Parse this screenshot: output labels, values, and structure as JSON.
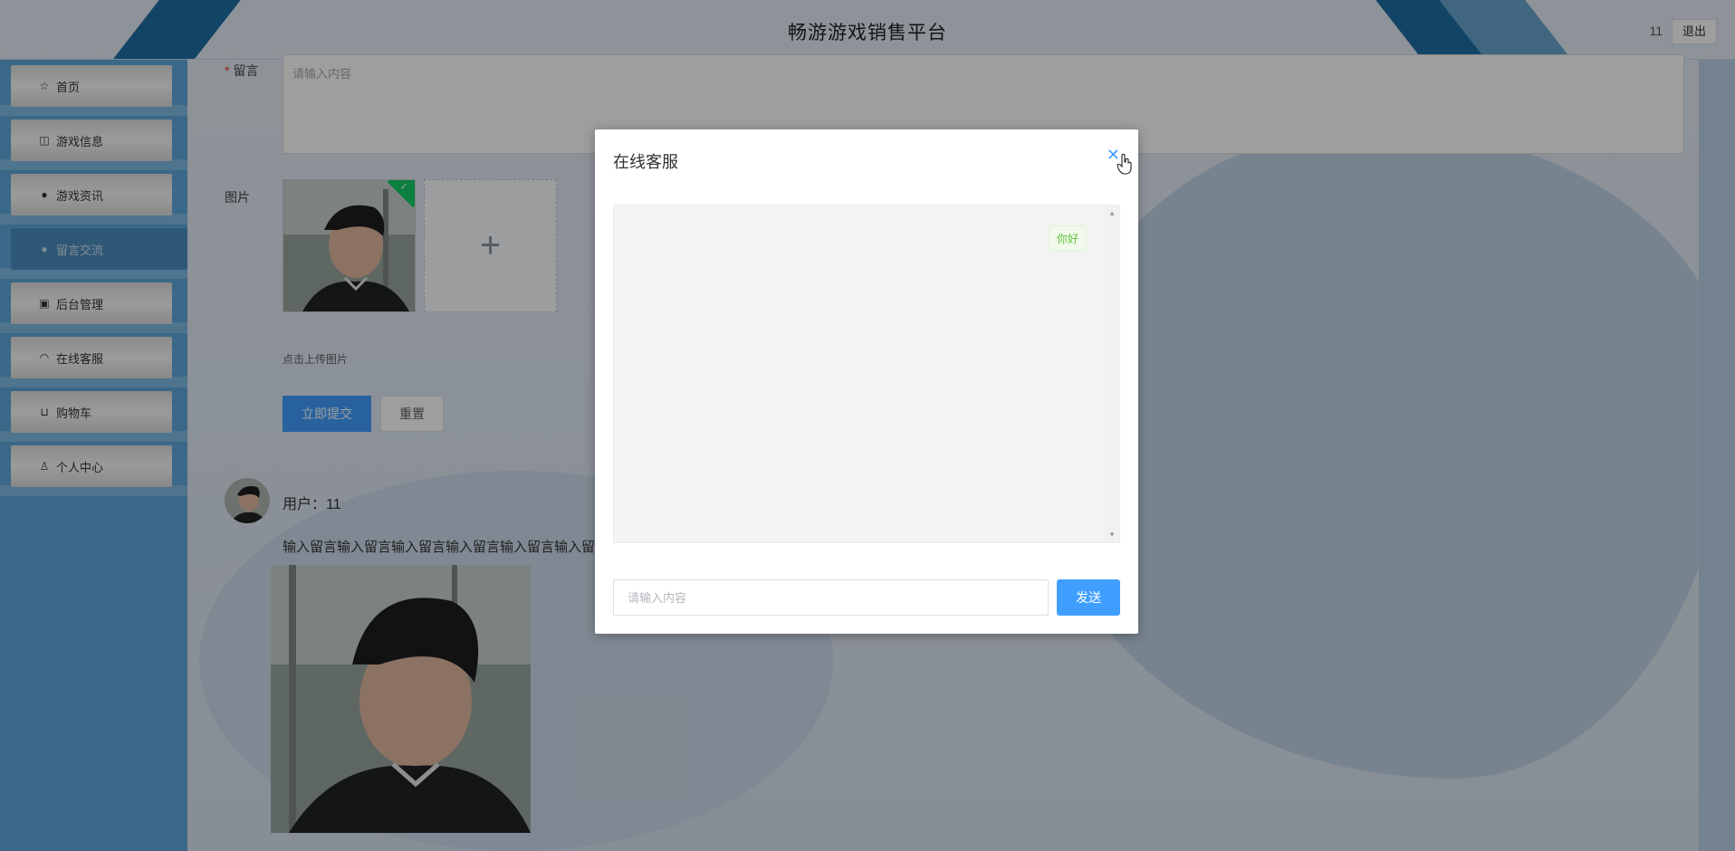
{
  "header": {
    "title": "畅游游戏销售平台",
    "username": "11",
    "logout_label": "退出"
  },
  "sidebar": {
    "items": [
      {
        "label": "首页",
        "icon": "star-icon"
      },
      {
        "label": "游戏信息",
        "icon": "bag-icon"
      },
      {
        "label": "游戏资讯",
        "icon": "info-icon"
      },
      {
        "label": "留言交流",
        "icon": "message-icon",
        "active": true
      },
      {
        "label": "后台管理",
        "icon": "briefcase-icon"
      },
      {
        "label": "在线客服",
        "icon": "headset-icon"
      },
      {
        "label": "购物车",
        "icon": "cart-icon"
      },
      {
        "label": "个人中心",
        "icon": "user-icon"
      }
    ]
  },
  "form": {
    "message_label": "留言",
    "message_placeholder": "请输入内容",
    "image_label": "图片",
    "upload_tip": "点击上传图片",
    "submit_label": "立即提交",
    "reset_label": "重置"
  },
  "comment": {
    "user_line": "用户：11",
    "text": "输入留言输入留言输入留言输入留言输入留言输入留言输入"
  },
  "dialog": {
    "title": "在线客服",
    "messages": [
      {
        "text": "你好",
        "side": "right"
      }
    ],
    "input_placeholder": "请输入内容",
    "send_label": "发送"
  },
  "colors": {
    "primary": "#409eff",
    "sidebar": "#5fa8dc",
    "header_stripe": "#1d6fa5",
    "success": "#13ce66"
  }
}
